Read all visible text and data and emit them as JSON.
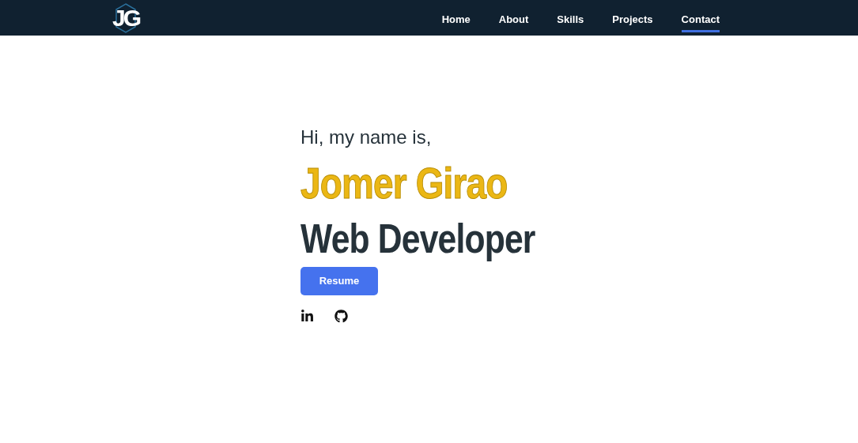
{
  "logo": "JG",
  "nav": [
    {
      "label": "Home",
      "selected": false
    },
    {
      "label": "About",
      "selected": false
    },
    {
      "label": "Skills",
      "selected": false
    },
    {
      "label": "Projects",
      "selected": false
    },
    {
      "label": "Contact",
      "selected": true
    }
  ],
  "hero": {
    "greeting": "Hi, my name is,",
    "name": "Jomer Girao",
    "role": "Web Developer",
    "button": "Resume"
  },
  "social": [
    {
      "kind": "linkedin"
    },
    {
      "kind": "github"
    }
  ]
}
